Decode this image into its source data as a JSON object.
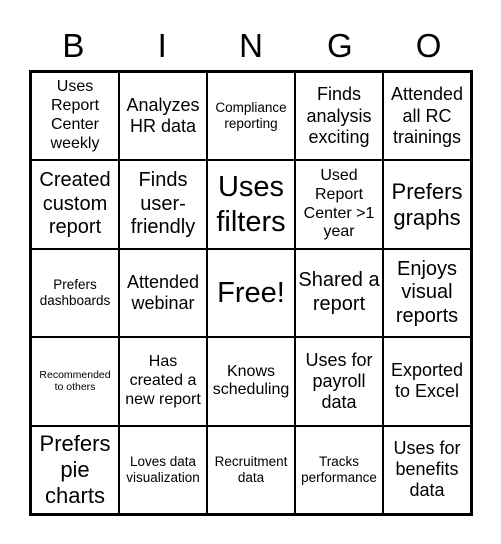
{
  "header": [
    "B",
    "I",
    "N",
    "G",
    "O"
  ],
  "cells": [
    "Uses Report Center weekly",
    "Analyzes HR data",
    "Compliance reporting",
    "Finds analysis exciting",
    "Attended all RC trainings",
    "Created custom report",
    "Finds user-friendly",
    "Uses filters",
    "Used Report Center >1 year",
    "Prefers graphs",
    "Prefers dashboards",
    "Attended webinar",
    "Free!",
    "Shared a report",
    "Enjoys visual reports",
    "Recommended to others",
    "Has created a new report",
    "Knows scheduling",
    "Uses for payroll data",
    "Exported to Excel",
    "Prefers pie charts",
    "Loves data visualization",
    "Recruitment data",
    "Tracks performance",
    "Uses for benefits data"
  ]
}
